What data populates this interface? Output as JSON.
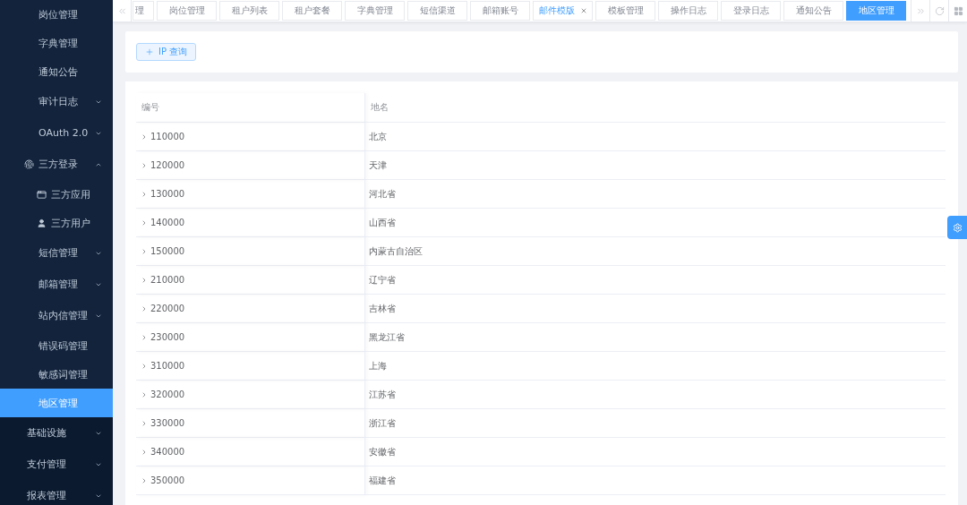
{
  "sidebar": {
    "submenu_items": [
      {
        "label": "岗位管理",
        "kind": "link",
        "selected": false
      },
      {
        "label": "字典管理",
        "kind": "link",
        "selected": false
      },
      {
        "label": "通知公告",
        "kind": "link",
        "selected": false
      },
      {
        "label": "审计日志",
        "kind": "group",
        "selected": false,
        "expanded": false
      },
      {
        "label": "OAuth 2.0",
        "kind": "group",
        "selected": false,
        "expanded": false
      },
      {
        "label": "三方登录",
        "kind": "group",
        "selected": false,
        "expanded": true,
        "icon": true,
        "children": [
          {
            "label": "三方应用",
            "kind": "link",
            "selected": false,
            "icon": true
          },
          {
            "label": "三方用户",
            "kind": "link",
            "selected": false,
            "icon": true
          }
        ]
      },
      {
        "label": "短信管理",
        "kind": "group",
        "selected": false,
        "expanded": false
      },
      {
        "label": "邮箱管理",
        "kind": "group",
        "selected": false,
        "expanded": false
      },
      {
        "label": "站内信管理",
        "kind": "group",
        "selected": false,
        "expanded": false
      },
      {
        "label": "错误码管理",
        "kind": "link",
        "selected": false
      },
      {
        "label": "敏感词管理",
        "kind": "link",
        "selected": false
      },
      {
        "label": "地区管理",
        "kind": "link",
        "selected": true
      }
    ],
    "items": [
      {
        "label": "基础设施",
        "kind": "group",
        "selected": false,
        "expanded": false
      },
      {
        "label": "支付管理",
        "kind": "group",
        "selected": false,
        "expanded": false
      },
      {
        "label": "报表管理",
        "kind": "group",
        "selected": false,
        "expanded": false
      }
    ]
  },
  "tabs": [
    {
      "label": "理",
      "kind": "cut",
      "selected": false,
      "hovered": false
    },
    {
      "label": "岗位管理",
      "kind": "full",
      "selected": false,
      "hovered": false
    },
    {
      "label": "租户列表",
      "kind": "full",
      "selected": false,
      "hovered": false
    },
    {
      "label": "租户套餐",
      "kind": "full",
      "selected": false,
      "hovered": false
    },
    {
      "label": "字典管理",
      "kind": "full",
      "selected": false,
      "hovered": false
    },
    {
      "label": "短信渠道",
      "kind": "full",
      "selected": false,
      "hovered": false
    },
    {
      "label": "邮箱账号",
      "kind": "full",
      "selected": false,
      "hovered": false
    },
    {
      "label": "邮件模版",
      "kind": "full",
      "selected": false,
      "hovered": true
    },
    {
      "label": "模板管理",
      "kind": "full",
      "selected": false,
      "hovered": false
    },
    {
      "label": "操作日志",
      "kind": "full",
      "selected": false,
      "hovered": false
    },
    {
      "label": "登录日志",
      "kind": "full",
      "selected": false,
      "hovered": false
    },
    {
      "label": "通知公告",
      "kind": "full",
      "selected": false,
      "hovered": false
    },
    {
      "label": "地区管理",
      "kind": "full",
      "selected": true,
      "hovered": false
    }
  ],
  "toolbar": {
    "buttons": [
      {
        "label": "IP 查询"
      }
    ]
  },
  "table": {
    "columns": [
      {
        "label": "编号"
      },
      {
        "label": "地名"
      }
    ],
    "rows": [
      {
        "code": "110000",
        "name": "北京",
        "expanded": false
      },
      {
        "code": "120000",
        "name": "天津",
        "expanded": false
      },
      {
        "code": "130000",
        "name": "河北省",
        "expanded": false
      },
      {
        "code": "140000",
        "name": "山西省",
        "expanded": false
      },
      {
        "code": "150000",
        "name": "内蒙古自治区",
        "expanded": false
      },
      {
        "code": "210000",
        "name": "辽宁省",
        "expanded": false
      },
      {
        "code": "220000",
        "name": "吉林省",
        "expanded": false
      },
      {
        "code": "230000",
        "name": "黑龙江省",
        "expanded": false
      },
      {
        "code": "310000",
        "name": "上海",
        "expanded": false
      },
      {
        "code": "320000",
        "name": "江苏省",
        "expanded": false
      },
      {
        "code": "330000",
        "name": "浙江省",
        "expanded": false
      },
      {
        "code": "340000",
        "name": "安徽省",
        "expanded": false
      },
      {
        "code": "350000",
        "name": "福建省",
        "expanded": false
      }
    ]
  }
}
